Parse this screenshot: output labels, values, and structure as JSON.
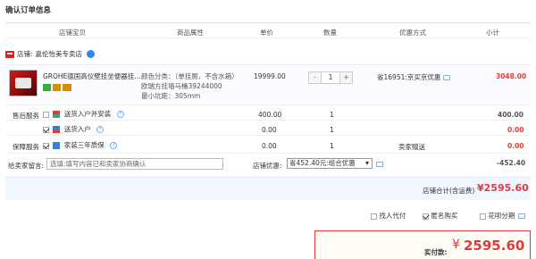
{
  "page_title": "确认订单信息",
  "columns": {
    "shop_item": "店铺宝贝",
    "attributes": "商品属性",
    "unit_price": "单价",
    "quantity": "数量",
    "discount": "优惠方式",
    "subtotal": "小计"
  },
  "shop": {
    "label": "店铺:",
    "name": "嘉伦怡美专卖店"
  },
  "item": {
    "name": "GROHE德国高仪壁挂坐便器挂...",
    "props_line1": "颜色分类：（单挂厕，不含水箱）",
    "props_line2": "欧瑞方挂墙马桶39244000",
    "props_line3": "最小坑距：305mm",
    "price": "19999.00",
    "qty_minus": "-",
    "qty_value": "1",
    "qty_plus": "+",
    "promo": "省16951:京买京优惠",
    "subtotal": "3048.00"
  },
  "services": [
    {
      "group_label": "售后服务",
      "checked": false,
      "name": "送货入户并安装",
      "price": "400.00",
      "qty": "1",
      "discount": "",
      "total": "400.00",
      "total_red": false
    },
    {
      "group_label": "",
      "checked": true,
      "name": "送货入户",
      "price": "0.00",
      "qty": "1",
      "discount": "",
      "total": "0.00",
      "total_red": true
    },
    {
      "group_label": "保障服务",
      "checked": true,
      "name": "家装三年质保",
      "price": "0.00",
      "qty": "1",
      "discount": "卖家赠送",
      "total": "0.00",
      "total_red": true
    }
  ],
  "message": {
    "label": "给卖家留言:",
    "placeholder": "选填:填写内容已和卖家协商确认"
  },
  "shop_discount": {
    "label": "店铺优惠:",
    "selected": "省452.40元:组合优惠",
    "amount": "-452.40"
  },
  "shop_total": {
    "label": "店铺合计(含运费)",
    "value": "¥2595.60"
  },
  "options": [
    {
      "label": "找人代付",
      "checked": false
    },
    {
      "label": "匿名购买",
      "checked": true
    },
    {
      "label": "花呗分期",
      "checked": false
    }
  ],
  "payment": {
    "label": "实付款:",
    "currency": "¥",
    "amount": "2595.60"
  },
  "colors": {
    "accent_red": "#e4393c",
    "link_blue": "#4a8fd8"
  }
}
